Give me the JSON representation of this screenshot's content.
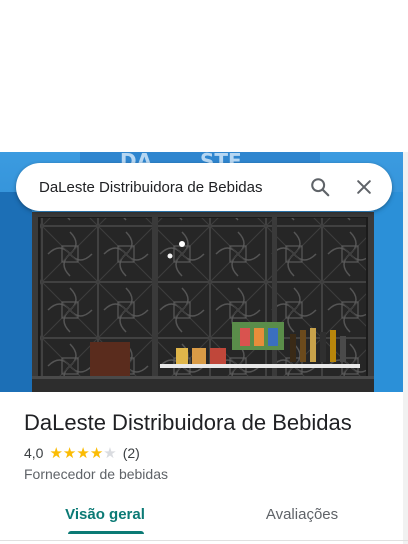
{
  "search": {
    "query": "DaLeste Distribuidora de Bebidas",
    "search_icon": "search-icon",
    "close_icon": "close-icon"
  },
  "place": {
    "name": "DaLeste Distribuidora de Bebidas",
    "rating_value": "4,0",
    "rating_stars": 4,
    "rating_max": 5,
    "review_count": "(2)",
    "category": "Fornecedor de bebidas"
  },
  "tabs": [
    {
      "label": "Visão geral",
      "active": true
    },
    {
      "label": "Avaliações",
      "active": false
    }
  ],
  "colors": {
    "accent": "#0b7a75",
    "star": "#fbbc04",
    "wall": "#2a8fd6"
  }
}
